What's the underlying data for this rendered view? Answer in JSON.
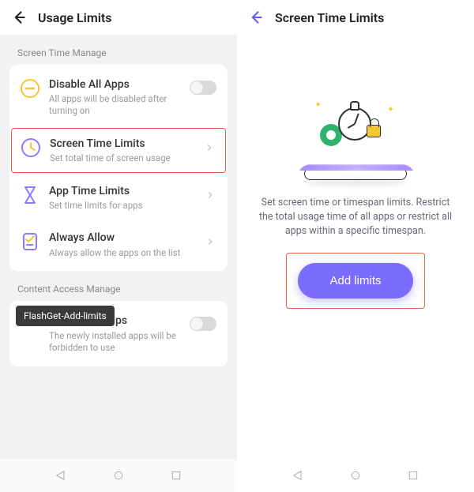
{
  "left": {
    "header": {
      "title": "Usage Limits"
    },
    "section1_label": "Screen Time Manage",
    "rows": {
      "disable": {
        "title": "Disable All Apps",
        "sub": "All apps will be disabled after turning on"
      },
      "screenTime": {
        "title": "Screen Time Limits",
        "sub": "Set total time of screen usage"
      },
      "appTime": {
        "title": "App Time Limits",
        "sub": "Set time limits for apps"
      },
      "always": {
        "title": "Always Allow",
        "sub": "Always allow the apps on the list"
      },
      "forbidNew": {
        "title_suffix": "ps",
        "sub": "The newly installed apps will be forbidden to use"
      }
    },
    "section2_label": "Content Access Manage",
    "tooltip": "FlashGet-Add-limits"
  },
  "right": {
    "header": {
      "title": "Screen Time Limits"
    },
    "description": "Set screen time or timespan limits. Restrict the total usage time of all apps or restrict all apps within a specific timespan.",
    "add_button": "Add limits"
  }
}
